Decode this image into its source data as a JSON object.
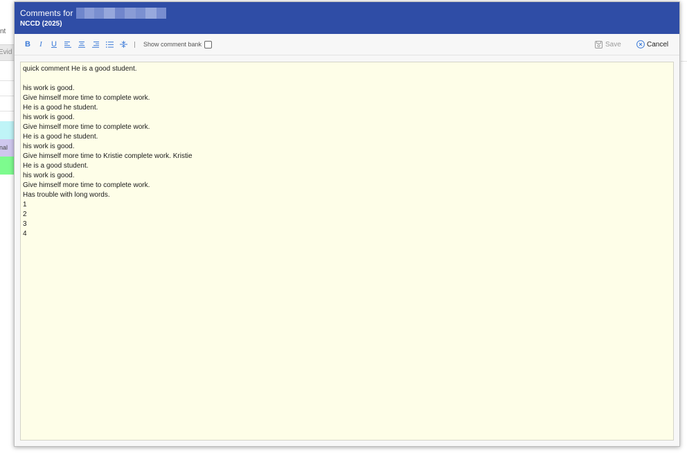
{
  "background": {
    "fragment_nt": "nt",
    "fragment_evid": "Evid",
    "fragment_onal": "onal"
  },
  "modal": {
    "title_prefix": "Comments for",
    "subtitle": "NCCD (2025)"
  },
  "toolbar": {
    "bold": "B",
    "italic": "I",
    "underline": "U",
    "show_comment_bank_label": "Show comment bank",
    "show_comment_bank_checked": false,
    "save_label": "Save",
    "cancel_label": "Cancel"
  },
  "colors": {
    "header": "#2f4da6",
    "toolbar_icon": "#3b7ad8",
    "editor_bg": "#fefee8"
  },
  "editor": {
    "lines": [
      "quick comment He is a good student.",
      "",
      "his work is good.",
      "Give himself more time to complete work.",
      "He is a good he student.",
      "his work is good.",
      "Give himself more time to complete work.",
      "He is a good he student.",
      "his work is good.",
      "Give himself more time to Kristie complete work. Kristie",
      "He is a good student.",
      "his work is good.",
      "Give himself more time to complete work.",
      "Has trouble with long words.",
      "1",
      "2",
      "3",
      "4"
    ]
  }
}
